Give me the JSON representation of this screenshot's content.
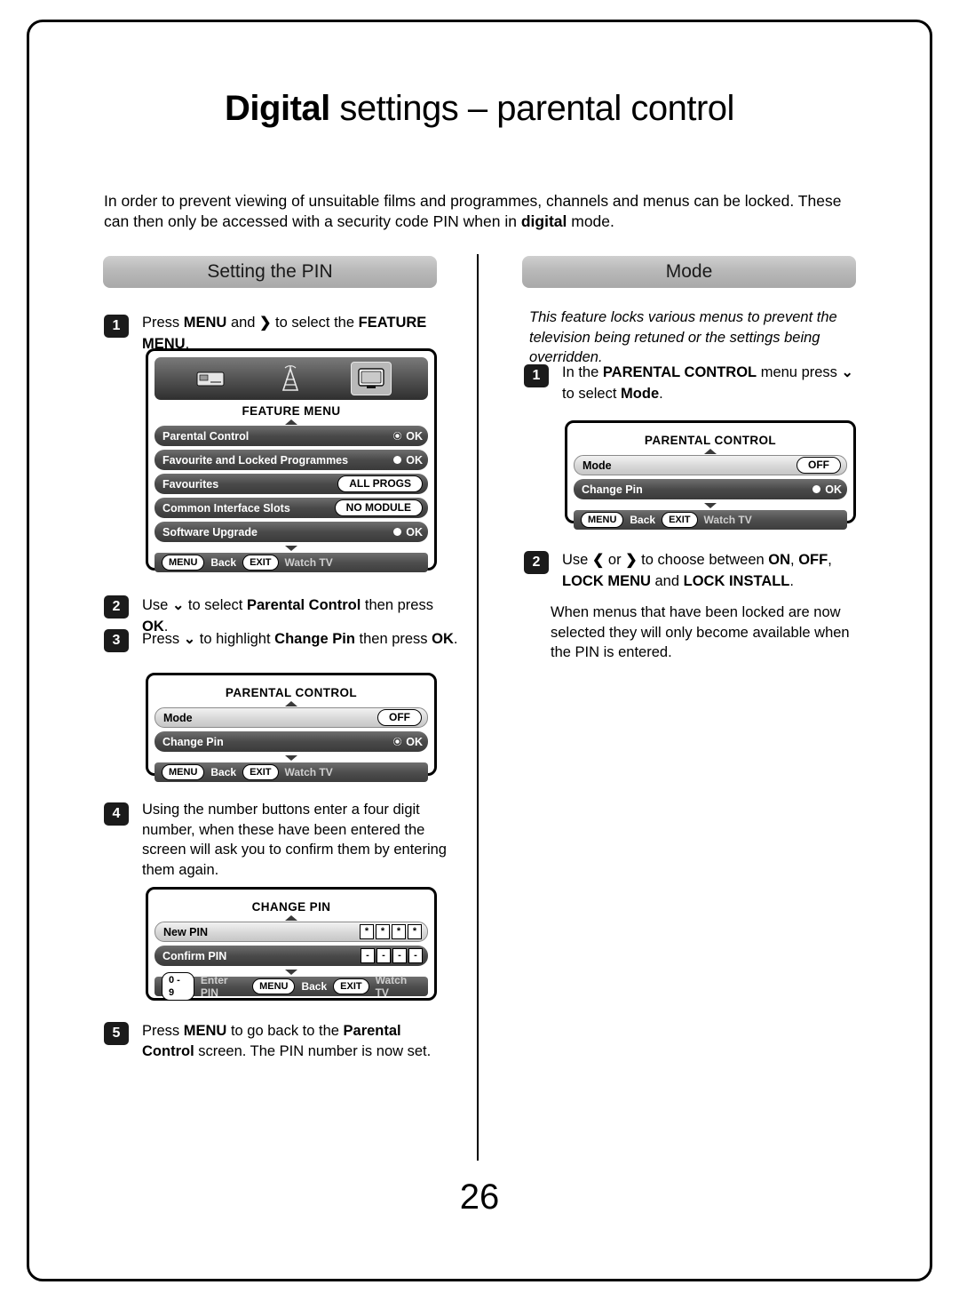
{
  "page": {
    "title_bold": "Digital",
    "title_rest": " settings – parental control",
    "number": "26",
    "intro": "In order to prevent viewing of unsuitable films and programmes, channels and menus can be locked. These can then only be accessed with a security code PIN when in digital mode."
  },
  "left": {
    "section_title": "Setting the PIN",
    "steps": [
      {
        "num": "1",
        "text": "Press MENU and ❯ to select the FEATURE MENU."
      },
      {
        "num": "2",
        "text": "Use ⌄ to select Parental Control then press OK."
      },
      {
        "num": "3",
        "text": "Press ⌄ to highlight Change Pin then press OK."
      },
      {
        "num": "4",
        "text": "Using the number buttons enter a four digit number, when these have been entered the screen will ask you to confirm them by entering them again."
      },
      {
        "num": "5",
        "text": "Press MENU to go back to the Parental Control screen. The PIN number is now set."
      }
    ],
    "feature_menu": {
      "title": "FEATURE MENU",
      "icons": [
        "card-icon",
        "tower-icon",
        "tv-icon"
      ],
      "rows": [
        {
          "label": "Parental Control",
          "value": "OK",
          "value_type": "ok-ring"
        },
        {
          "label": "Favourite and Locked Programmes",
          "value": "OK",
          "value_type": "ok-dot"
        },
        {
          "label": "Favourites",
          "value": "ALL PROGS",
          "value_type": "pill"
        },
        {
          "label": "Common Interface Slots",
          "value": "NO MODULE",
          "value_type": "pill"
        },
        {
          "label": "Software Upgrade",
          "value": "OK",
          "value_type": "ok-dot"
        }
      ],
      "footer": {
        "key1": "MENU",
        "label1": "Back",
        "key2": "EXIT",
        "label2": "Watch TV"
      }
    },
    "parental_control": {
      "title": "PARENTAL CONTROL",
      "rows": [
        {
          "label": "Mode",
          "value": "OFF",
          "value_type": "pill",
          "highlight": "light"
        },
        {
          "label": "Change Pin",
          "value": "OK",
          "value_type": "ok-ring",
          "highlight": "dark"
        }
      ],
      "footer": {
        "key1": "MENU",
        "label1": "Back",
        "key2": "EXIT",
        "label2": "Watch TV"
      }
    },
    "change_pin": {
      "title": "CHANGE PIN",
      "rows": [
        {
          "label": "New PIN",
          "digits": [
            "*",
            "*",
            "*",
            "*"
          ],
          "highlight": "light"
        },
        {
          "label": "Confirm PIN",
          "digits": [
            "-",
            "-",
            "-",
            "-"
          ],
          "highlight": "dark"
        }
      ],
      "footer": {
        "range": "0 - 9",
        "range_label": "Enter PIN",
        "key1": "MENU",
        "label1": "Back",
        "key2": "EXIT",
        "label2": "Watch TV"
      }
    }
  },
  "right": {
    "section_title": "Mode",
    "note": "This feature locks various menus to prevent the television being retuned or the settings being overridden.",
    "steps": [
      {
        "num": "1",
        "text": "In the PARENTAL CONTROL menu press ⌄ to select Mode."
      },
      {
        "num": "2",
        "text": "Use ❮ or ❯ to choose between ON, OFF, LOCK MENU and LOCK INSTALL."
      }
    ],
    "body": "When menus that have been locked are now selected they will only become available when the PIN is entered.",
    "parental_control": {
      "title": "PARENTAL CONTROL",
      "rows": [
        {
          "label": "Mode",
          "value": "OFF",
          "value_type": "pill",
          "highlight": "light"
        },
        {
          "label": "Change Pin",
          "value": "OK",
          "value_type": "ok-dot",
          "highlight": "dark"
        }
      ],
      "footer": {
        "key1": "MENU",
        "label1": "Back",
        "key2": "EXIT",
        "label2": "Watch TV"
      }
    }
  }
}
